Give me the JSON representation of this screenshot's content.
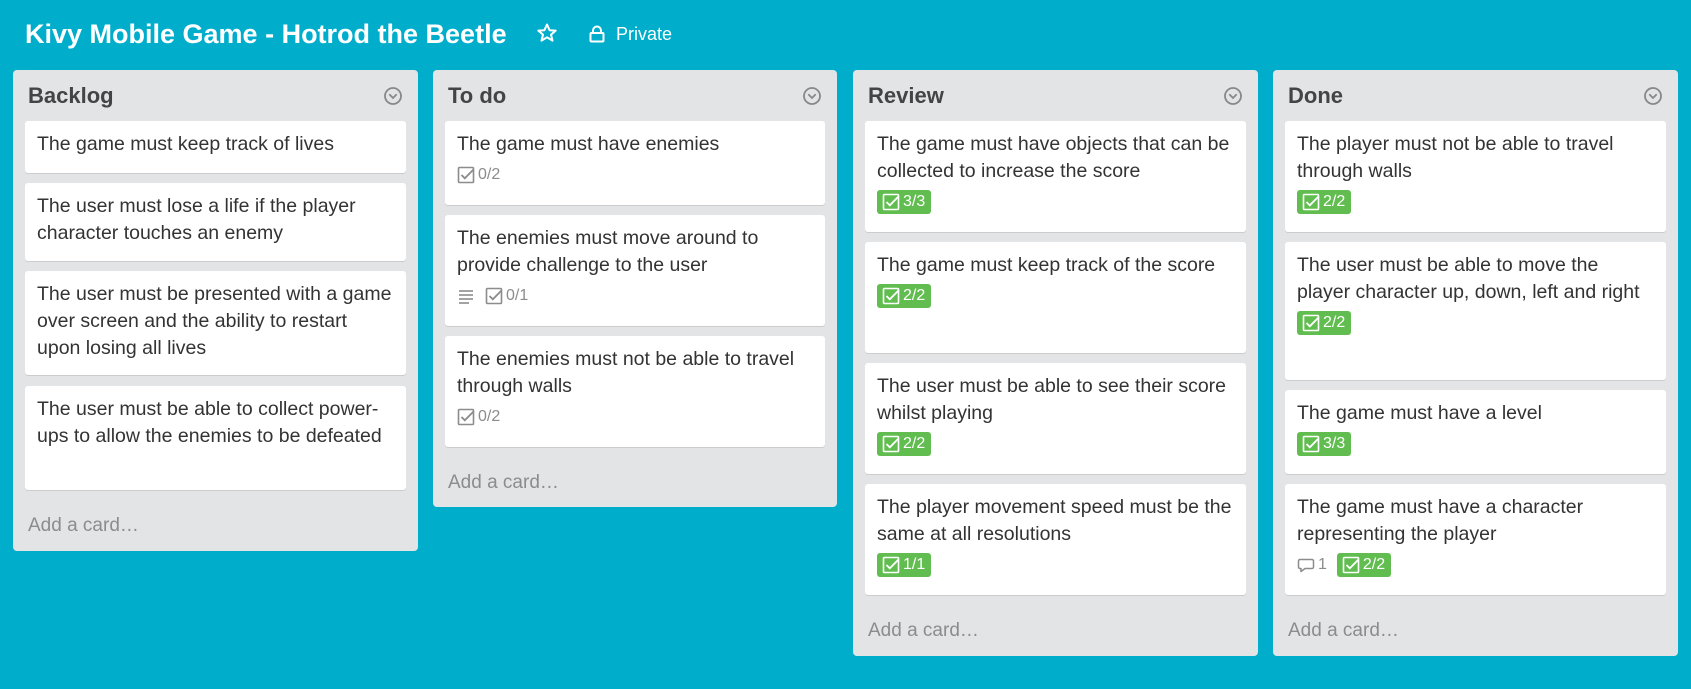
{
  "board": {
    "title": "Kivy Mobile Game - Hotrod the Beetle",
    "privacy_label": "Private",
    "star_icon": "star-icon",
    "lock_icon": "lock-icon"
  },
  "colors": {
    "background": "#00aecc",
    "list_bg": "#e2e4e6",
    "badge_complete": "#61bd4f",
    "muted_text": "#8c8c8c"
  },
  "lists": [
    {
      "title": "Backlog",
      "add_card_label": "Add a card…",
      "cards": [
        {
          "title": "The game must keep track of lives"
        },
        {
          "title": "The user must lose a life if the player character touches an enemy"
        },
        {
          "title": "The user must be presented with a game over screen and the ability to restart upon losing all lives"
        },
        {
          "title": "The user must be able to collect power-ups to allow the enemies to be defeated"
        }
      ]
    },
    {
      "title": "To do",
      "add_card_label": "Add a card…",
      "cards": [
        {
          "title": "The game must have enemies",
          "checklist": "0/2",
          "complete": false
        },
        {
          "title": "The enemies must move around to provide challenge to the user",
          "description": true,
          "checklist": "0/1",
          "complete": false
        },
        {
          "title": "The enemies must not be able to travel through walls",
          "checklist": "0/2",
          "complete": false
        }
      ]
    },
    {
      "title": "Review",
      "add_card_label": "Add a card…",
      "cards": [
        {
          "title": "The game must have objects that can be collected to increase the score",
          "checklist": "3/3",
          "complete": true
        },
        {
          "title": "The game must keep track of the score",
          "checklist": "2/2",
          "complete": true
        },
        {
          "title": "The user must be able to see their score whilst playing",
          "checklist": "2/2",
          "complete": true
        },
        {
          "title": "The player movement speed must be the same at all resolutions",
          "checklist": "1/1",
          "complete": true
        }
      ]
    },
    {
      "title": "Done",
      "add_card_label": "Add a card…",
      "cards": [
        {
          "title": "The player must not be able to travel through walls",
          "checklist": "2/2",
          "complete": true
        },
        {
          "title": "The user must be able to move the player character up, down, left and right",
          "checklist": "2/2",
          "complete": true
        },
        {
          "title": "The game must have a level",
          "checklist": "3/3",
          "complete": true
        },
        {
          "title": "The game must have a character representing the player",
          "comments": "1",
          "checklist": "2/2",
          "complete": true
        }
      ]
    }
  ]
}
